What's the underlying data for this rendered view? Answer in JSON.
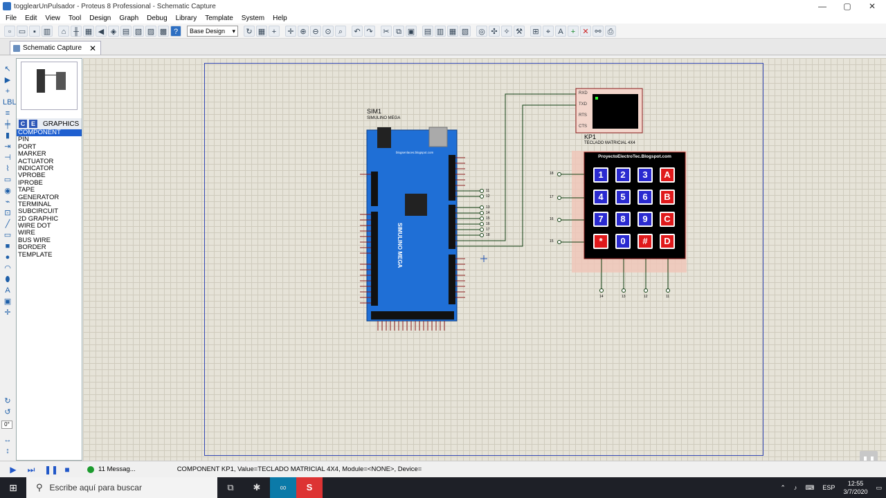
{
  "window": {
    "title": "togglearUnPulsador - Proteus 8 Professional - Schematic Capture"
  },
  "menu": [
    "File",
    "Edit",
    "View",
    "Tool",
    "Design",
    "Graph",
    "Debug",
    "Library",
    "Template",
    "System",
    "Help"
  ],
  "toolbar": {
    "design_select": "Base Design"
  },
  "tab": {
    "label": "Schematic Capture",
    "close": "✕"
  },
  "panel": {
    "c": "C",
    "e": "E",
    "label": "GRAPHICS",
    "modes": [
      "COMPONENT",
      "PIN",
      "PORT",
      "MARKER",
      "ACTUATOR",
      "INDICATOR",
      "VPROBE",
      "IPROBE",
      "TAPE",
      "GENERATOR",
      "TERMINAL",
      "SUBCIRCUIT",
      "2D GRAPHIC",
      "WIRE DOT",
      "WIRE",
      "BUS WIRE",
      "BORDER",
      "TEMPLATE"
    ],
    "selected": "COMPONENT"
  },
  "rotation": "0°",
  "schematic": {
    "sim1_ref": "SIM1",
    "sim1_name": "SIMULINO MEGA",
    "board_text": "SIMULINO MEGA",
    "board_site": "blogsenlaces.blogspot.com",
    "terminal_pins": [
      "RXD",
      "TXD",
      "RTS",
      "CTS"
    ],
    "kp1_ref": "KP1",
    "kp1_name": "TECLADO MATRICIAL 4X4",
    "kp_banner": "ProyectoElectroTec.Blogspot.com",
    "keys": [
      "1",
      "2",
      "3",
      "A",
      "4",
      "5",
      "6",
      "B",
      "7",
      "8",
      "9",
      "C",
      "*",
      "0",
      "#",
      "D"
    ],
    "row_nets": [
      "18",
      "17",
      "16",
      "15"
    ],
    "col_nets": [
      "14",
      "13",
      "12",
      "11"
    ],
    "right_nets_a": [
      "11",
      "12"
    ],
    "right_nets_b": [
      "13",
      "14",
      "15",
      "16",
      "17",
      "18"
    ]
  },
  "status": {
    "messages": "11 Messag...",
    "text": "COMPONENT KP1, Value=TECLADO MATRICIAL 4X4, Module=<NONE>, Device="
  },
  "taskbar": {
    "search_placeholder": "Escribe aquí para buscar",
    "lang": "ESP",
    "time": "12:55",
    "date": "3/7/2020"
  }
}
